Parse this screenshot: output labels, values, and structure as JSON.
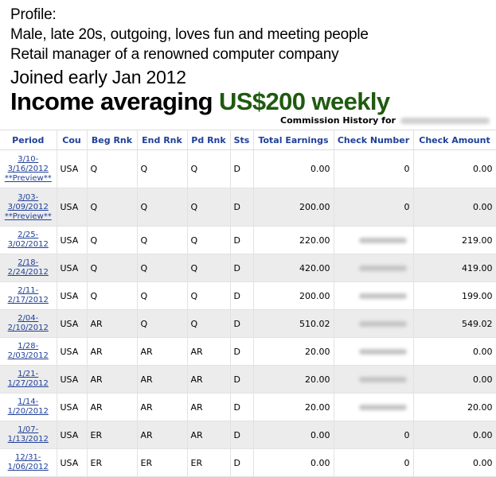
{
  "profile": {
    "heading": "Profile:",
    "line1": "Male, late 20s, outgoing, loves fun and meeting people",
    "line2": "Retail manager of a renowned computer company",
    "joined": "Joined early Jan 2012",
    "income_prefix": "Income averaging ",
    "income_amount": "US$200 weekly",
    "income_amount_color": "#1f5a0f"
  },
  "commission_title": "Commission History for",
  "table": {
    "headers": [
      "Period",
      "Cou",
      "Beg Rnk",
      "End Rnk",
      "Pd Rnk",
      "Sts",
      "Total Earnings",
      "Check Number",
      "Check Amount"
    ],
    "header_color": "#1f3f99",
    "rows": [
      {
        "period_line1": "3/10-",
        "period_line2": "3/16/2012",
        "preview": "**Preview**",
        "cou": "USA",
        "beg": "Q",
        "end": "Q",
        "pd": "Q",
        "sts": "D",
        "total": "0.00",
        "check_number": "0",
        "check_amount": "0.00"
      },
      {
        "period_line1": "3/03-",
        "period_line2": "3/09/2012",
        "preview": "**Preview**",
        "cou": "USA",
        "beg": "Q",
        "end": "Q",
        "pd": "Q",
        "sts": "D",
        "total": "200.00",
        "check_number": "0",
        "check_amount": "0.00"
      },
      {
        "period_line1": "2/25-",
        "period_line2": "3/02/2012",
        "cou": "USA",
        "beg": "Q",
        "end": "Q",
        "pd": "Q",
        "sts": "D",
        "total": "220.00",
        "check_amount": "219.00"
      },
      {
        "period_line1": "2/18-",
        "period_line2": "2/24/2012",
        "cou": "USA",
        "beg": "Q",
        "end": "Q",
        "pd": "Q",
        "sts": "D",
        "total": "420.00",
        "check_amount": "419.00"
      },
      {
        "period_line1": "2/11-",
        "period_line2": "2/17/2012",
        "cou": "USA",
        "beg": "Q",
        "end": "Q",
        "pd": "Q",
        "sts": "D",
        "total": "200.00",
        "check_amount": "199.00"
      },
      {
        "period_line1": "2/04-",
        "period_line2": "2/10/2012",
        "cou": "USA",
        "beg": "AR",
        "end": "Q",
        "pd": "Q",
        "sts": "D",
        "total": "510.02",
        "check_amount": "549.02"
      },
      {
        "period_line1": "1/28-",
        "period_line2": "2/03/2012",
        "cou": "USA",
        "beg": "AR",
        "end": "AR",
        "pd": "AR",
        "sts": "D",
        "total": "20.00",
        "check_amount": "0.00"
      },
      {
        "period_line1": "1/21-",
        "period_line2": "1/27/2012",
        "cou": "USA",
        "beg": "AR",
        "end": "AR",
        "pd": "AR",
        "sts": "D",
        "total": "20.00",
        "check_amount": "0.00"
      },
      {
        "period_line1": "1/14-",
        "period_line2": "1/20/2012",
        "cou": "USA",
        "beg": "AR",
        "end": "AR",
        "pd": "AR",
        "sts": "D",
        "total": "20.00",
        "check_amount": "20.00"
      },
      {
        "period_line1": "1/07-",
        "period_line2": "1/13/2012",
        "cou": "USA",
        "beg": "ER",
        "end": "AR",
        "pd": "AR",
        "sts": "D",
        "total": "0.00",
        "check_number": "0",
        "check_amount": "0.00"
      },
      {
        "period_line1": "12/31-",
        "period_line2": "1/06/2012",
        "cou": "USA",
        "beg": "ER",
        "end": "ER",
        "pd": "ER",
        "sts": "D",
        "total": "0.00",
        "check_number": "0",
        "check_amount": "0.00"
      }
    ]
  }
}
